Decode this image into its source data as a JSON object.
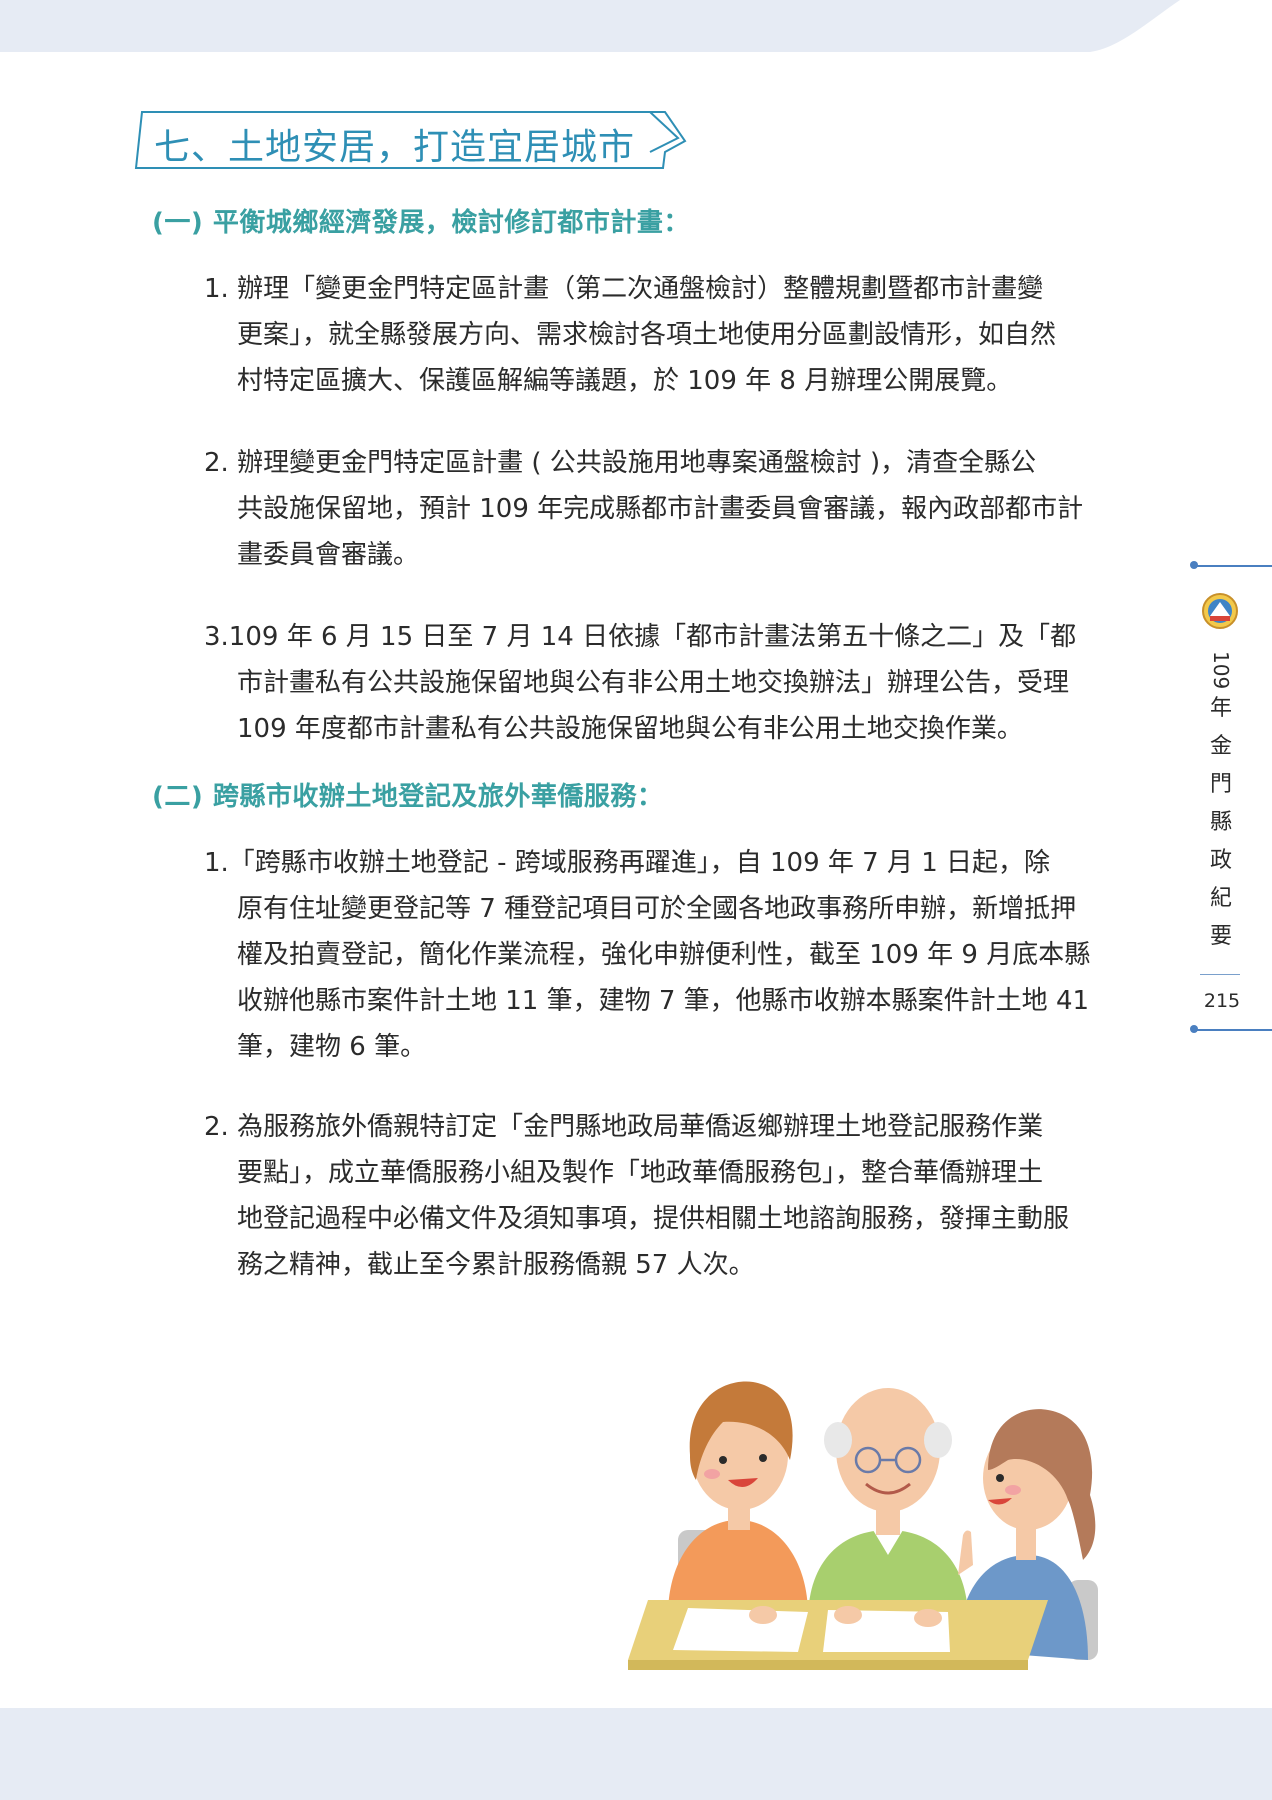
{
  "section": {
    "title": "七、土地安居，打造宜居城市"
  },
  "subsections": [
    {
      "heading": "(一) 平衡城鄉經濟發展，檢討修訂都市計畫：",
      "items": [
        {
          "lines": [
            "1. 辦理「變更金門特定區計畫（第二次通盤檢討）整體規劃暨都市計畫變",
            "更案」，就全縣發展方向、需求檢討各項土地使用分區劃設情形，如自然",
            "村特定區擴大、保護區解編等議題，於 109 年 8 月辦理公開展覽。"
          ]
        },
        {
          "lines": [
            "2. 辦理變更金門特定區計畫 ( 公共設施用地專案通盤檢討 )，清查全縣公",
            "共設施保留地，預計 109 年完成縣都市計畫委員會審議，報內政部都市計",
            "畫委員會審議。"
          ]
        },
        {
          "lines": [
            "3.109 年 6 月 15 日至 7 月 14 日依據「都市計畫法第五十條之二」及「都",
            "市計畫私有公共設施保留地與公有非公用土地交換辦法」辦理公告，受理",
            "109 年度都市計畫私有公共設施保留地與公有非公用土地交換作業。"
          ]
        }
      ]
    },
    {
      "heading": "(二) 跨縣市收辦土地登記及旅外華僑服務：",
      "items": [
        {
          "lines": [
            "1.「跨縣市收辦土地登記 - 跨域服務再躍進」，自 109 年 7 月 1 日起，除",
            "原有住址變更登記等 7 種登記項目可於全國各地政事務所申辦，新增抵押",
            "權及拍賣登記，簡化作業流程，強化申辦便利性，截至 109 年 9 月底本縣",
            "收辦他縣市案件計土地 11 筆，建物 7 筆，他縣市收辦本縣案件計土地 41",
            "筆，建物 6 筆。"
          ]
        },
        {
          "lines": [
            "2. 為服務旅外僑親特訂定「金門縣地政局華僑返鄉辦理土地登記服務作業",
            "要點」，成立華僑服務小組及製作「地政華僑服務包」，整合華僑辦理土",
            "地登記過程中必備文件及須知事項，提供相關土地諮詢服務，發揮主動服",
            "務之精神，截止至今累計服務僑親 57 人次。"
          ]
        }
      ]
    }
  ],
  "side_tab": {
    "chars": [
      "109",
      "年",
      "金",
      "門",
      "縣",
      "政",
      "紀",
      "要"
    ],
    "page_number": "215",
    "logo_icon": "county-emblem-icon"
  },
  "colors": {
    "title": "#2e8fb5",
    "subheading": "#3aa0a2",
    "accent_line": "#4a7fc0",
    "band": "#e6ebf4"
  }
}
